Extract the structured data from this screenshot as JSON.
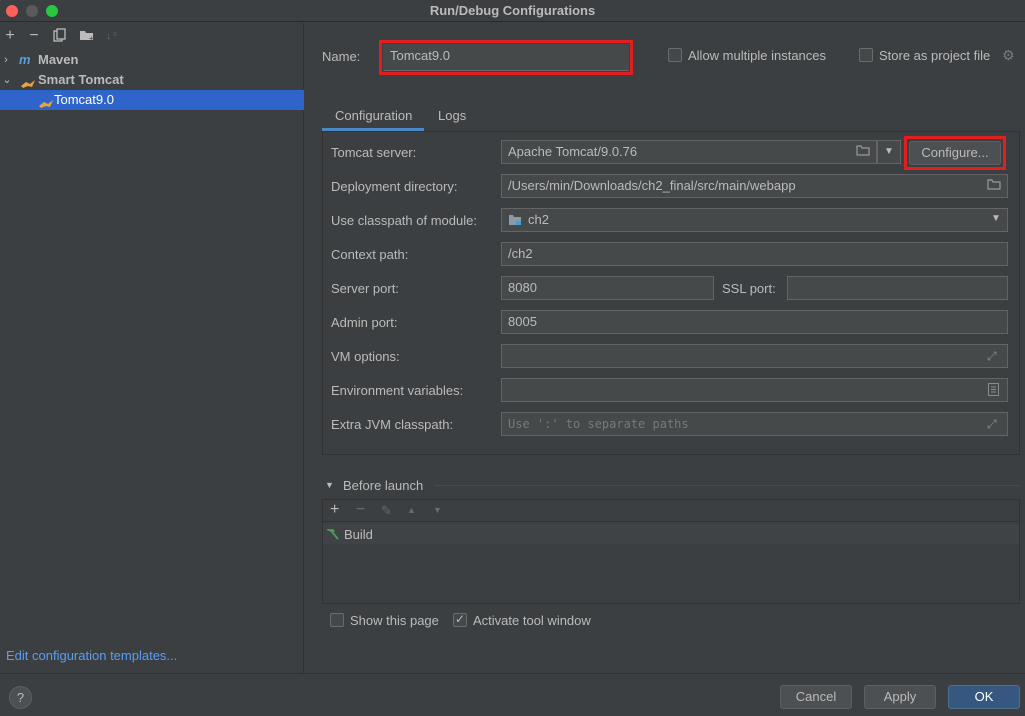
{
  "window": {
    "title": "Run/Debug Configurations",
    "traffic_colors": [
      "#fe5f57",
      "#febc2e",
      "#28c840"
    ]
  },
  "sidebar": {
    "tree": [
      {
        "label": "Maven"
      },
      {
        "label": "Smart Tomcat"
      },
      {
        "label": "Tomcat9.0"
      }
    ],
    "edit_templates": "Edit configuration templates..."
  },
  "form": {
    "name_label": "Name:",
    "name_value": "Tomcat9.0",
    "allow_multiple": "Allow multiple instances",
    "store_project": "Store as project file",
    "tabs": [
      {
        "label": "Configuration"
      },
      {
        "label": "Logs"
      }
    ],
    "rows": {
      "tomcat_server": {
        "label": "Tomcat server:",
        "value": "Apache Tomcat/9.0.76"
      },
      "deployment_dir": {
        "label": "Deployment directory:",
        "value": "/Users/min/Downloads/ch2_final/src/main/webapp"
      },
      "classpath_module": {
        "label": "Use classpath of module:",
        "value": "ch2"
      },
      "context_path": {
        "label": "Context path:",
        "value": "/ch2"
      },
      "server_port": {
        "label": "Server port:",
        "value": "8080"
      },
      "ssl_port": {
        "label": "SSL port:",
        "value": ""
      },
      "admin_port": {
        "label": "Admin port:",
        "value": "8005"
      },
      "vm_options": {
        "label": "VM options:",
        "value": ""
      },
      "env_vars": {
        "label": "Environment variables:",
        "value": ""
      },
      "extra_jvm": {
        "label": "Extra JVM classpath:",
        "placeholder": "Use ':' to separate paths"
      }
    },
    "configure_button": "Configure...",
    "before_launch": {
      "title": "Before launch",
      "items": [
        {
          "label": "Build"
        }
      ]
    },
    "show_page": "Show this page",
    "activate_tool": "Activate tool window"
  },
  "footer": {
    "help": "?",
    "cancel": "Cancel",
    "apply": "Apply",
    "ok": "OK"
  }
}
